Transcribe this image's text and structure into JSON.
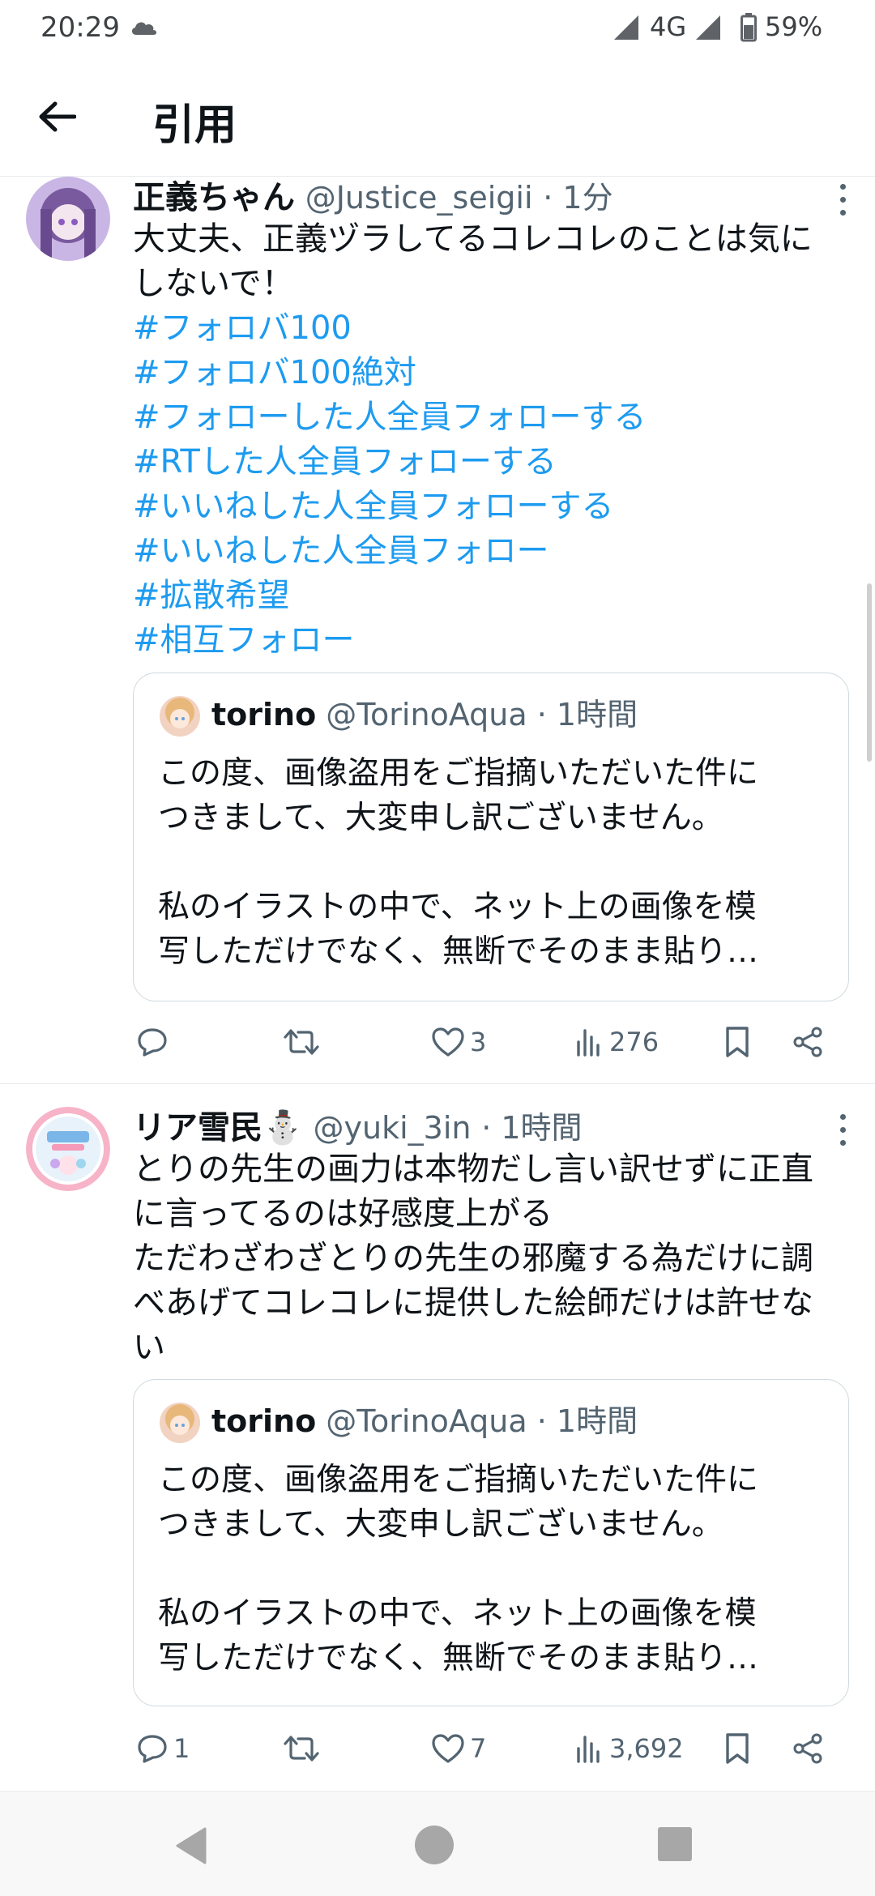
{
  "status_bar": {
    "time": "20:29",
    "network": "4G",
    "battery": "59%"
  },
  "header": {
    "title": "引用"
  },
  "tweets": [
    {
      "display_name": "正義ちゃん",
      "handle": "@Justice_seigii",
      "time": "· 1分",
      "text_lines": [
        "大丈夫、正義ヅラしてるコレコレのことは気に",
        "しないで！"
      ],
      "hashtags": [
        "#フォロバ100",
        "#フォロバ100絶対",
        "#フォローした人全員フォローする",
        "#RTした人全員フォローする",
        "#いいねした人全員フォローする",
        "#いいねした人全員フォロー",
        "#拡散希望",
        "#相互フォロー"
      ],
      "quote": {
        "display_name": "torino",
        "handle": "@TorinoAqua",
        "time": "· 1時間",
        "lines": [
          "この度、画像盗用をご指摘いただいた件に",
          "つきまして、大変申し訳ございません。",
          "",
          "私のイラストの中で、ネット上の画像を模",
          "写しただけでなく、無断でそのまま貼り…"
        ]
      },
      "actions": {
        "replies": "",
        "retweets": "",
        "likes": "3",
        "views": "276"
      }
    },
    {
      "display_name": "リア雪民⛄",
      "handle": "@yuki_3in",
      "time": "· 1時間",
      "text_lines": [
        "とりの先生の画力は本物だし言い訳せずに正直",
        "に言ってるのは好感度上がる",
        "ただわざわざとりの先生の邪魔する為だけに調",
        "べあげてコレコレに提供した絵師だけは許せな",
        "い"
      ],
      "hashtags": [],
      "quote": {
        "display_name": "torino",
        "handle": "@TorinoAqua",
        "time": "· 1時間",
        "lines": [
          "この度、画像盗用をご指摘いただいた件に",
          "つきまして、大変申し訳ございません。",
          "",
          "私のイラストの中で、ネット上の画像を模",
          "写しただけでなく、無断でそのまま貼り…"
        ]
      },
      "actions": {
        "replies": "1",
        "retweets": "",
        "likes": "7",
        "views": "3,692"
      }
    }
  ],
  "colors": {
    "hashtag": "#1d9bf0",
    "secondary_text": "#536471",
    "border": "#cfd9de"
  },
  "icons": [
    "cloud-icon",
    "signal-icon",
    "battery-icon",
    "back-arrow-icon",
    "more-icon",
    "reply-icon",
    "retweet-icon",
    "like-icon",
    "views-icon",
    "bookmark-icon",
    "share-icon"
  ]
}
